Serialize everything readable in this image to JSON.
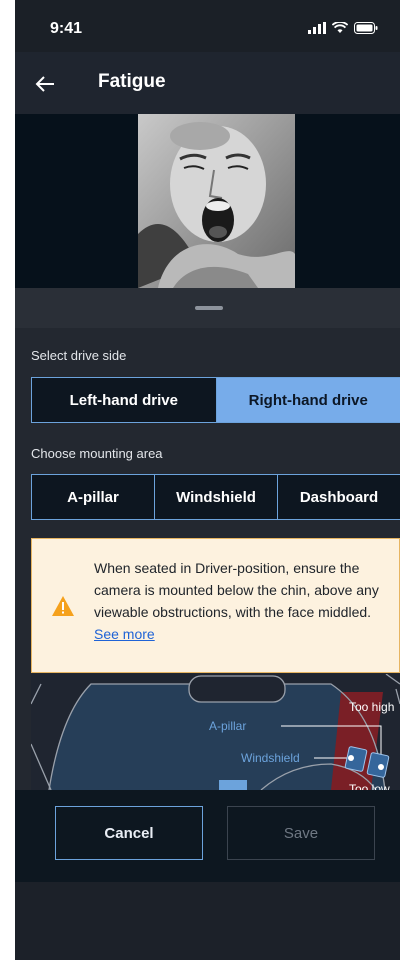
{
  "status_bar": {
    "time": "9:41"
  },
  "header": {
    "title": "Fatigue"
  },
  "preview": {
    "icon": "driver-yawning-photo"
  },
  "drive_side": {
    "label": "Select drive side",
    "options": [
      "Left-hand drive",
      "Right-hand drive"
    ],
    "selected": "Right-hand drive"
  },
  "mounting": {
    "label": "Choose mounting area",
    "options": [
      "A-pillar",
      "Windshield",
      "Dashboard"
    ]
  },
  "notice": {
    "text": "When seated in Driver-position, ensure the camera is mounted below the chin, above any viewable obstructions, with the face middled.",
    "link": "See more",
    "accent_color": "#f5a11c"
  },
  "diagram": {
    "labels": {
      "a_pillar": "A-pillar",
      "windshield": "Windshield",
      "too_high": "Too high",
      "too_low": "Too low"
    },
    "zone_color": "#7a1f26",
    "accent_color": "#6ca3dc"
  },
  "actions": {
    "cancel": "Cancel",
    "save": "Save"
  },
  "colors": {
    "primary": "#77acea",
    "background": "#1c2129"
  }
}
